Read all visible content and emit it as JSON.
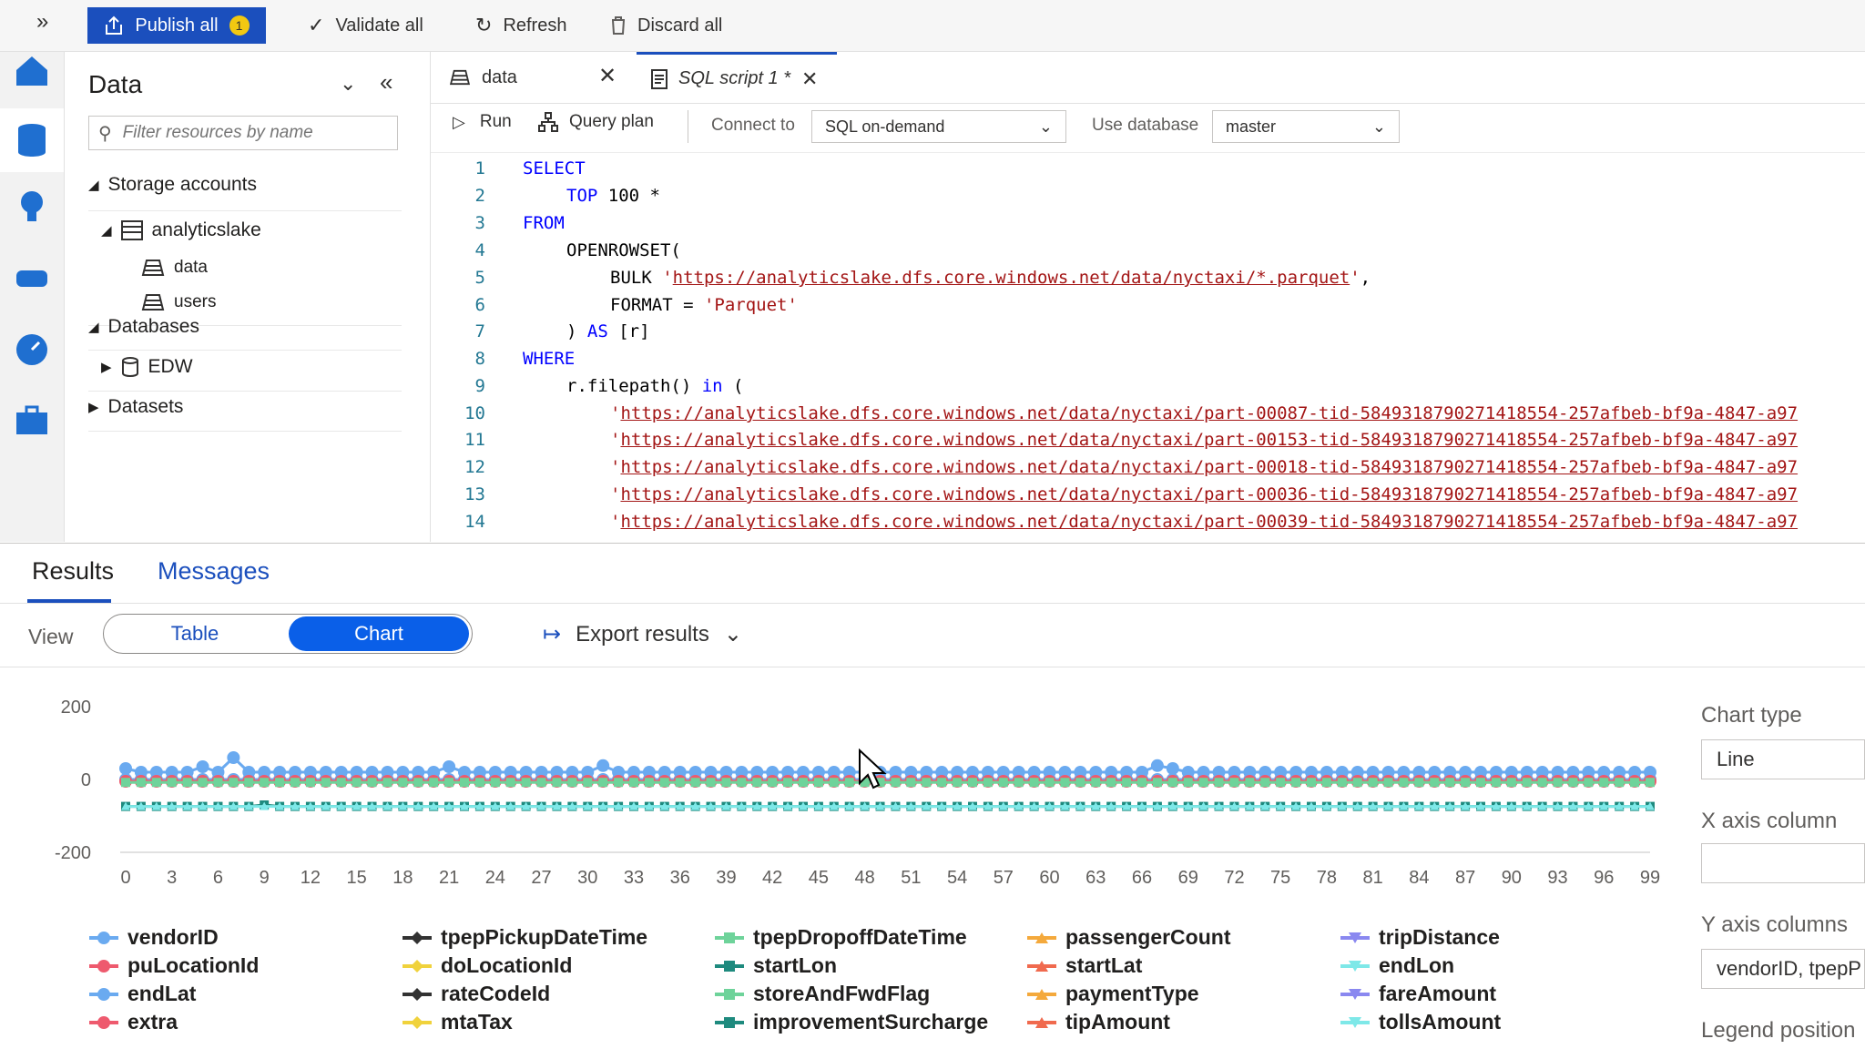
{
  "toolbar": {
    "publish_label": "Publish all",
    "publish_count": "1",
    "validate_label": "Validate all",
    "refresh_label": "Refresh",
    "discard_label": "Discard all"
  },
  "data_panel": {
    "title": "Data",
    "filter_placeholder": "Filter resources by name",
    "storage_label": "Storage accounts",
    "account": "analyticslake",
    "containers": [
      "data",
      "users"
    ],
    "databases_label": "Databases",
    "database": "EDW",
    "datasets_label": "Datasets"
  },
  "tabs": [
    {
      "label": "data"
    },
    {
      "label": "SQL script 1 *"
    }
  ],
  "editor_toolbar": {
    "run": "Run",
    "query_plan": "Query plan",
    "connect_to_label": "Connect to",
    "connect_to_value": "SQL on-demand",
    "use_db_label": "Use database",
    "use_db_value": "master"
  },
  "code": {
    "line_numbers": [
      "1",
      "2",
      "3",
      "4",
      "5",
      "6",
      "7",
      "8",
      "9",
      "10",
      "11",
      "12",
      "13",
      "14"
    ],
    "l1": "SELECT",
    "l2_kw": "TOP",
    "l2_rest": " 100 *",
    "l3": "FROM",
    "l4": "OPENROWSET(",
    "l5_kw": "BULK",
    "l5_url": "https://analyticslake.dfs.core.windows.net/data/nyctaxi/*.parquet",
    "l6_a": "FORMAT = ",
    "l6_str": "'Parquet'",
    "l7_a": ") ",
    "l7_kw": "AS",
    "l7_b": " [r]",
    "l8": "WHERE",
    "l9_a": "r.filepath() ",
    "l9_kw": "in",
    "l9_b": " (",
    "url_lines": [
      "https://analyticslake.dfs.core.windows.net/data/nyctaxi/part-00087-tid-5849318790271418554-257afbeb-bf9a-4847-a97",
      "https://analyticslake.dfs.core.windows.net/data/nyctaxi/part-00153-tid-5849318790271418554-257afbeb-bf9a-4847-a97",
      "https://analyticslake.dfs.core.windows.net/data/nyctaxi/part-00018-tid-5849318790271418554-257afbeb-bf9a-4847-a97",
      "https://analyticslake.dfs.core.windows.net/data/nyctaxi/part-00036-tid-5849318790271418554-257afbeb-bf9a-4847-a97",
      "https://analyticslake.dfs.core.windows.net/data/nyctaxi/part-00039-tid-5849318790271418554-257afbeb-bf9a-4847-a97"
    ]
  },
  "results": {
    "tab_results": "Results",
    "tab_messages": "Messages",
    "view_label": "View",
    "toggle_table": "Table",
    "toggle_chart": "Chart",
    "export_label": "Export results"
  },
  "side_panel": {
    "chart_type_label": "Chart type",
    "chart_type_value": "Line",
    "x_axis_label": "X axis column",
    "x_axis_value": "",
    "y_axis_label": "Y axis columns",
    "y_axis_value": "vendorID, tpepP",
    "legend_label": "Legend position"
  },
  "legend": [
    {
      "name": "vendorID",
      "color": "#6aaaf0",
      "marker": "circle"
    },
    {
      "name": "tpepPickupDateTime",
      "color": "#323232",
      "marker": "diamond"
    },
    {
      "name": "tpepDropoffDateTime",
      "color": "#6ed39a",
      "marker": "square"
    },
    {
      "name": "passengerCount",
      "color": "#f4a93c",
      "marker": "triangle"
    },
    {
      "name": "tripDistance",
      "color": "#8a88f0",
      "marker": "triangle-down"
    },
    {
      "name": "puLocationId",
      "color": "#ee5a6e",
      "marker": "circle"
    },
    {
      "name": "doLocationId",
      "color": "#f0d23c",
      "marker": "diamond"
    },
    {
      "name": "startLon",
      "color": "#1e8a7e",
      "marker": "square"
    },
    {
      "name": "startLat",
      "color": "#f06a4e",
      "marker": "triangle"
    },
    {
      "name": "endLon",
      "color": "#7ee8e8",
      "marker": "triangle-down"
    },
    {
      "name": "endLat",
      "color": "#6aaaf0",
      "marker": "circle"
    },
    {
      "name": "rateCodeId",
      "color": "#323232",
      "marker": "diamond"
    },
    {
      "name": "storeAndFwdFlag",
      "color": "#6ed39a",
      "marker": "square"
    },
    {
      "name": "paymentType",
      "color": "#f4a93c",
      "marker": "triangle"
    },
    {
      "name": "fareAmount",
      "color": "#8a88f0",
      "marker": "triangle-down"
    },
    {
      "name": "extra",
      "color": "#ee5a6e",
      "marker": "circle"
    },
    {
      "name": "mtaTax",
      "color": "#f0d23c",
      "marker": "diamond"
    },
    {
      "name": "improvementSurcharge",
      "color": "#1e8a7e",
      "marker": "square"
    },
    {
      "name": "tipAmount",
      "color": "#f06a4e",
      "marker": "triangle"
    },
    {
      "name": "tollsAmount",
      "color": "#7ee8e8",
      "marker": "triangle-down"
    }
  ],
  "chart_data": {
    "type": "line",
    "title": "",
    "xlabel": "",
    "ylabel": "",
    "xlim": [
      0,
      99
    ],
    "ylim": [
      -200,
      200
    ],
    "yticks": [
      200,
      0,
      -200
    ],
    "xticks": [
      0,
      3,
      6,
      9,
      12,
      15,
      18,
      21,
      24,
      27,
      30,
      33,
      36,
      39,
      42,
      45,
      48,
      51,
      54,
      57,
      60,
      63,
      66,
      69,
      72,
      75,
      78,
      81,
      84,
      87,
      90,
      93,
      96,
      99
    ],
    "grid": false,
    "legend_position": "bottom",
    "series": [
      {
        "name": "vendorID",
        "baseline": 20,
        "peaks": {
          "0": 30,
          "5": 35,
          "7": 60,
          "21": 35,
          "31": 38,
          "67": 38,
          "68": 30
        }
      },
      {
        "name": "endLat",
        "baseline": 0
      },
      {
        "name": "puLocationId",
        "baseline": -5
      },
      {
        "name": "tpepDropoffDateTime",
        "baseline": -8
      },
      {
        "name": "startLon",
        "baseline": -74,
        "peaks": {
          "9": -70
        }
      },
      {
        "name": "endLon",
        "baseline": -74
      }
    ]
  }
}
